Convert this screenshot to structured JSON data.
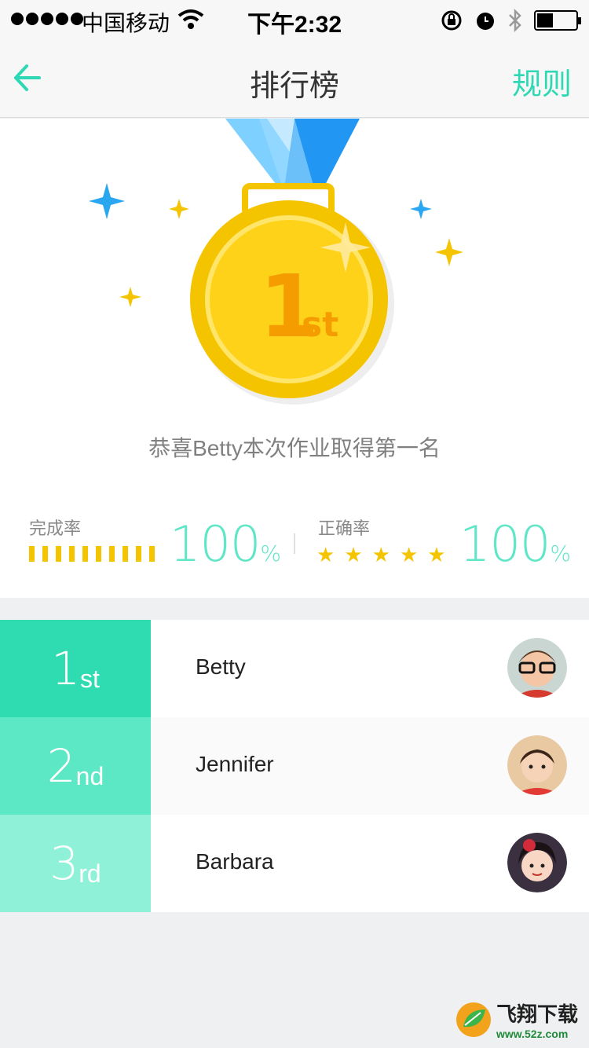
{
  "status_bar": {
    "carrier": "中国移动",
    "time": "下午2:32"
  },
  "nav": {
    "title": "排行榜",
    "rule_label": "规则"
  },
  "medal": {
    "rank_number": "1",
    "rank_suffix": "st",
    "congrats_text": "恭喜Betty本次作业取得第一名"
  },
  "stats": {
    "completion": {
      "label": "完成率",
      "value": "100",
      "unit": "%",
      "percent": 100
    },
    "accuracy": {
      "label": "正确率",
      "value": "100",
      "unit": "%",
      "stars": 5
    }
  },
  "ranking": [
    {
      "rank_number": "1",
      "rank_suffix": "st",
      "name": "Betty",
      "color": "#2fdcb1",
      "row_bg": "#ffffff"
    },
    {
      "rank_number": "2",
      "rank_suffix": "nd",
      "name": "Jennifer",
      "color": "#5ce8c4",
      "row_bg": "#fafafa"
    },
    {
      "rank_number": "3",
      "rank_suffix": "rd",
      "name": "Barbara",
      "color": "#8ff2d8",
      "row_bg": "#ffffff"
    }
  ],
  "watermark": {
    "text": "飞翔下载",
    "url": "www.52z.com"
  },
  "colors": {
    "accent": "#2fd8b4",
    "gold": "#f5c400",
    "ribbon": "#3aa8f5"
  }
}
